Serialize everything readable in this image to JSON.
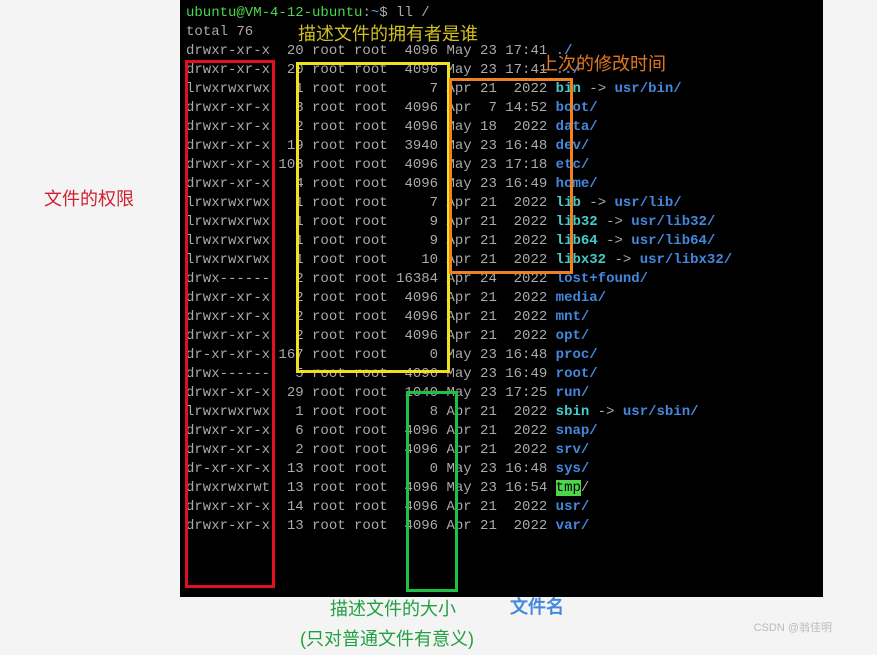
{
  "prompt": {
    "user": "ubuntu",
    "host": "VM-4-12-ubuntu",
    "path": "~",
    "symbol": "$",
    "command": "ll /"
  },
  "total_line": "total 76",
  "annotations": {
    "permissions": "文件的权限",
    "owner": "描述文件的拥有者是谁",
    "mtime": "上次的修改时间",
    "size": "描述文件的大小",
    "size_note": "(只对普通文件有意义)",
    "filename": "文件名"
  },
  "watermark": "CSDN @翁佳明",
  "rows": [
    {
      "perms": "drwxr-xr-x",
      "links": "20",
      "owner": "root",
      "group": "root",
      "size": "4096",
      "date": "May 23 17:41",
      "name": "./",
      "type": "dir"
    },
    {
      "perms": "drwxr-xr-x",
      "links": "20",
      "owner": "root",
      "group": "root",
      "size": "4096",
      "date": "May 23 17:41",
      "name": "../",
      "type": "dir"
    },
    {
      "perms": "lrwxrwxrwx",
      "links": "1",
      "owner": "root",
      "group": "root",
      "size": "7",
      "date": "Apr 21  2022",
      "name": "bin",
      "type": "link",
      "arrow": " -> ",
      "target": "usr/bin/"
    },
    {
      "perms": "drwxr-xr-x",
      "links": "3",
      "owner": "root",
      "group": "root",
      "size": "4096",
      "date": "Apr  7 14:52",
      "name": "boot/",
      "type": "dir"
    },
    {
      "perms": "drwxr-xr-x",
      "links": "2",
      "owner": "root",
      "group": "root",
      "size": "4096",
      "date": "May 18  2022",
      "name": "data/",
      "type": "dir"
    },
    {
      "perms": "drwxr-xr-x",
      "links": "19",
      "owner": "root",
      "group": "root",
      "size": "3940",
      "date": "May 23 16:48",
      "name": "dev/",
      "type": "dir"
    },
    {
      "perms": "drwxr-xr-x",
      "links": "103",
      "owner": "root",
      "group": "root",
      "size": "4096",
      "date": "May 23 17:18",
      "name": "etc/",
      "type": "dir"
    },
    {
      "perms": "drwxr-xr-x",
      "links": "4",
      "owner": "root",
      "group": "root",
      "size": "4096",
      "date": "May 23 16:49",
      "name": "home/",
      "type": "dir"
    },
    {
      "perms": "lrwxrwxrwx",
      "links": "1",
      "owner": "root",
      "group": "root",
      "size": "7",
      "date": "Apr 21  2022",
      "name": "lib",
      "type": "link",
      "arrow": " -> ",
      "target": "usr/lib/"
    },
    {
      "perms": "lrwxrwxrwx",
      "links": "1",
      "owner": "root",
      "group": "root",
      "size": "9",
      "date": "Apr 21  2022",
      "name": "lib32",
      "type": "link",
      "arrow": " -> ",
      "target": "usr/lib32/"
    },
    {
      "perms": "lrwxrwxrwx",
      "links": "1",
      "owner": "root",
      "group": "root",
      "size": "9",
      "date": "Apr 21  2022",
      "name": "lib64",
      "type": "link",
      "arrow": " -> ",
      "target": "usr/lib64/"
    },
    {
      "perms": "lrwxrwxrwx",
      "links": "1",
      "owner": "root",
      "group": "root",
      "size": "10",
      "date": "Apr 21  2022",
      "name": "libx32",
      "type": "link",
      "arrow": " -> ",
      "target": "usr/libx32/"
    },
    {
      "perms": "drwx------",
      "links": "2",
      "owner": "root",
      "group": "root",
      "size": "16384",
      "date": "Apr 24  2022",
      "name": "lost+found/",
      "type": "dir"
    },
    {
      "perms": "drwxr-xr-x",
      "links": "2",
      "owner": "root",
      "group": "root",
      "size": "4096",
      "date": "Apr 21  2022",
      "name": "media/",
      "type": "dir"
    },
    {
      "perms": "drwxr-xr-x",
      "links": "2",
      "owner": "root",
      "group": "root",
      "size": "4096",
      "date": "Apr 21  2022",
      "name": "mnt/",
      "type": "dir"
    },
    {
      "perms": "drwxr-xr-x",
      "links": "2",
      "owner": "root",
      "group": "root",
      "size": "4096",
      "date": "Apr 21  2022",
      "name": "opt/",
      "type": "dir"
    },
    {
      "perms": "dr-xr-xr-x",
      "links": "167",
      "owner": "root",
      "group": "root",
      "size": "0",
      "date": "May 23 16:48",
      "name": "proc/",
      "type": "dir"
    },
    {
      "perms": "drwx------",
      "links": "5",
      "owner": "root",
      "group": "root",
      "size": "4096",
      "date": "May 23 16:49",
      "name": "root/",
      "type": "dir"
    },
    {
      "perms": "drwxr-xr-x",
      "links": "29",
      "owner": "root",
      "group": "root",
      "size": "1040",
      "date": "May 23 17:25",
      "name": "run/",
      "type": "dir"
    },
    {
      "perms": "lrwxrwxrwx",
      "links": "1",
      "owner": "root",
      "group": "root",
      "size": "8",
      "date": "Apr 21  2022",
      "name": "sbin",
      "type": "link",
      "arrow": " -> ",
      "target": "usr/sbin/"
    },
    {
      "perms": "drwxr-xr-x",
      "links": "6",
      "owner": "root",
      "group": "root",
      "size": "4096",
      "date": "Apr 21  2022",
      "name": "snap/",
      "type": "dir"
    },
    {
      "perms": "drwxr-xr-x",
      "links": "2",
      "owner": "root",
      "group": "root",
      "size": "4096",
      "date": "Apr 21  2022",
      "name": "srv/",
      "type": "dir"
    },
    {
      "perms": "dr-xr-xr-x",
      "links": "13",
      "owner": "root",
      "group": "root",
      "size": "0",
      "date": "May 23 16:48",
      "name": "sys/",
      "type": "dir"
    },
    {
      "perms": "drwxrwxrwt",
      "links": "13",
      "owner": "root",
      "group": "root",
      "size": "4096",
      "date": "May 23 16:54",
      "name": "tmp",
      "type": "sticky",
      "tail": "/"
    },
    {
      "perms": "drwxr-xr-x",
      "links": "14",
      "owner": "root",
      "group": "root",
      "size": "4096",
      "date": "Apr 21  2022",
      "name": "usr/",
      "type": "dir"
    },
    {
      "perms": "drwxr-xr-x",
      "links": "13",
      "owner": "root",
      "group": "root",
      "size": "4096",
      "date": "Apr 21  2022",
      "name": "var/",
      "type": "dir"
    }
  ]
}
